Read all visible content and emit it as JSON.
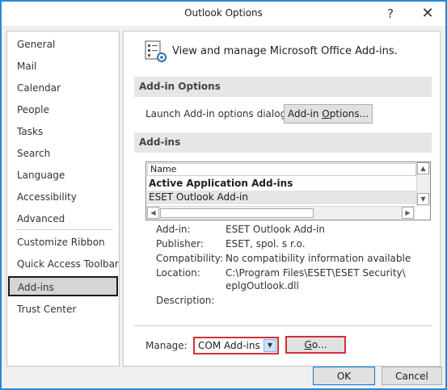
{
  "window": {
    "title": "Outlook Options",
    "help_glyph": "?",
    "close_glyph": "✕"
  },
  "sidebar": {
    "items": [
      {
        "label": "General"
      },
      {
        "label": "Mail"
      },
      {
        "label": "Calendar"
      },
      {
        "label": "People"
      },
      {
        "label": "Tasks"
      },
      {
        "label": "Search"
      },
      {
        "label": "Language"
      },
      {
        "label": "Accessibility"
      },
      {
        "label": "Advanced"
      },
      {
        "label": "Customize Ribbon"
      },
      {
        "label": "Quick Access Toolbar"
      },
      {
        "label": "Add-ins",
        "selected": true
      },
      {
        "label": "Trust Center"
      }
    ]
  },
  "main": {
    "header": "View and manage Microsoft Office Add-ins.",
    "addin_options": {
      "section_title": "Add-in Options",
      "launch_label": "Launch Add-in options dialog:",
      "button_pre": "Add-in ",
      "button_underlined": "O",
      "button_post": "ptions..."
    },
    "addins": {
      "section_title": "Add-ins",
      "column_header": "Name",
      "rows": [
        {
          "text": "Active Application Add-ins",
          "bold": true
        },
        {
          "text": "ESET Outlook Add-in",
          "selected": true
        }
      ]
    },
    "details": {
      "addin_label": "Add-in:",
      "addin_value": "ESET Outlook Add-in",
      "publisher_label": "Publisher:",
      "publisher_value": "ESET, spol. s r.o.",
      "compat_label": "Compatibility:",
      "compat_value": "No compatibility information available",
      "location_label": "Location:",
      "location_line1": "C:\\Program Files\\ESET\\ESET Security\\",
      "location_line2": "eplgOutlook.dll",
      "description_label": "Description:"
    },
    "manage": {
      "label": "Manage:",
      "selected": "COM Add-ins",
      "go_underlined": "G",
      "go_rest": "o..."
    }
  },
  "footer": {
    "ok_label": "OK",
    "cancel_label": "Cancel"
  },
  "colors": {
    "window_border": "#2b88d8",
    "highlight_box": "#d32f3a",
    "default_button": "#0078d7"
  }
}
